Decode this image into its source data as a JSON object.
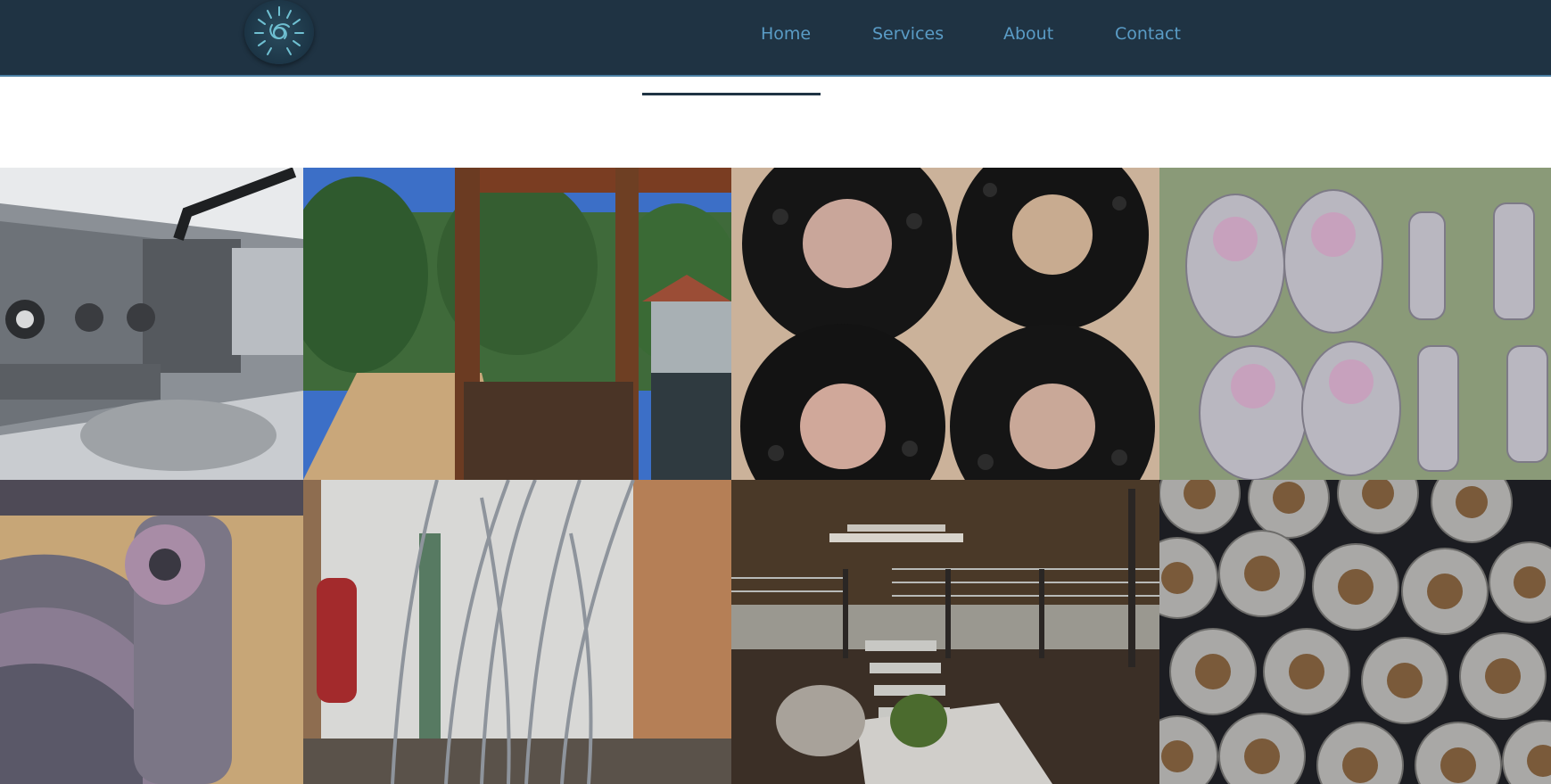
{
  "nav": {
    "logo_icon": "sunburst-spiral-logo",
    "links": [
      {
        "label": "Home"
      },
      {
        "label": "Services"
      },
      {
        "label": "About"
      },
      {
        "label": "Contact"
      }
    ]
  },
  "colors": {
    "navbar_bg": "#1f3343",
    "nav_link": "#5a9cc6",
    "accent_border": "#4a7fa3",
    "page_bg": "#ffffff"
  },
  "gallery": {
    "images": [
      {
        "subject": "linear-rail-clamp-photo"
      },
      {
        "subject": "garden-pergola-photo"
      },
      {
        "subject": "black-flanges-photo"
      },
      {
        "subject": "stainless-brackets-photo"
      },
      {
        "subject": "welded-clamp-photo"
      },
      {
        "subject": "metal-grass-sculpture-photo"
      },
      {
        "subject": "cable-railing-stairs-photo"
      },
      {
        "subject": "left-hand-thread-nuts-photo"
      }
    ]
  }
}
